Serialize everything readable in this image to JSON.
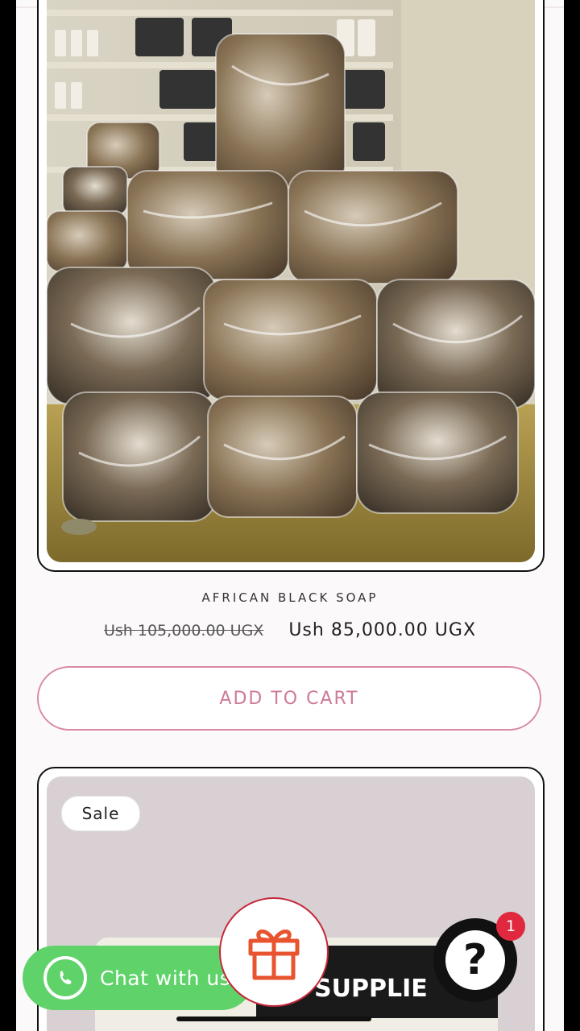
{
  "product1": {
    "title": "AFRICAN BLACK SOAP",
    "price_old": "Ush 105,000.00 UGX",
    "price_new": "Ush 85,000.00 UGX",
    "add_to_cart_label": "ADD TO CART"
  },
  "product2": {
    "sale_badge": "Sale",
    "image_text": "S SUPPLIE"
  },
  "floating": {
    "chat_label": "Chat with us",
    "help_glyph": "?",
    "notification_count": "1"
  },
  "colors": {
    "accent_pink": "#cf7a96",
    "whatsapp_green": "#5fd36a",
    "notification_red": "#e0283f"
  }
}
